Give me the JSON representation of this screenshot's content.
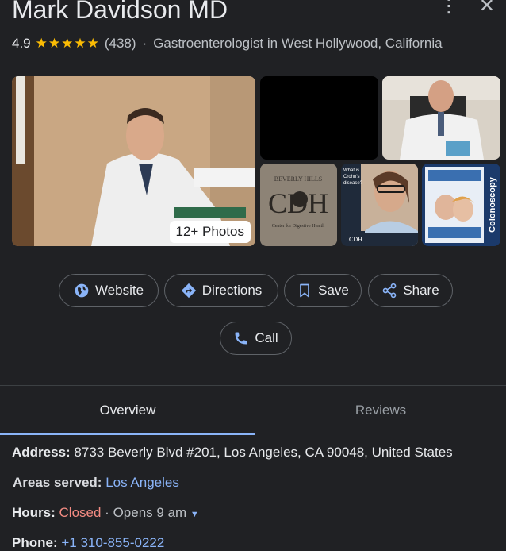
{
  "header": {
    "title": "Mark Davidson MD",
    "rating": "4.9",
    "stars": "★★★★★",
    "review_count": "(438)",
    "separator": "·",
    "category": "Gastroenterologist in West Hollywood, California"
  },
  "photos": {
    "badge": "12+ Photos"
  },
  "actions": {
    "website": "Website",
    "directions": "Directions",
    "save": "Save",
    "share": "Share",
    "call": "Call"
  },
  "tabs": {
    "overview": "Overview",
    "reviews": "Reviews"
  },
  "details": {
    "address_label": "Address:",
    "address_value": "8733 Beverly Blvd #201, Los Angeles, CA 90048, United States",
    "areas_label": "Areas served:",
    "areas_value": "Los Angeles",
    "hours_label": "Hours:",
    "hours_status": "Closed",
    "hours_sep": "·",
    "hours_next": "Opens 9 am",
    "phone_label": "Phone:",
    "phone_value": "+1 310-855-0222"
  },
  "colors": {
    "background": "#202124",
    "accent": "#8ab4f8",
    "star": "#fbbc04",
    "closed": "#f28b82"
  },
  "icons": [
    "more-vert-icon",
    "close-icon",
    "globe-icon",
    "directions-icon",
    "bookmark-icon",
    "share-icon",
    "phone-icon",
    "dropdown-arrow-icon"
  ]
}
